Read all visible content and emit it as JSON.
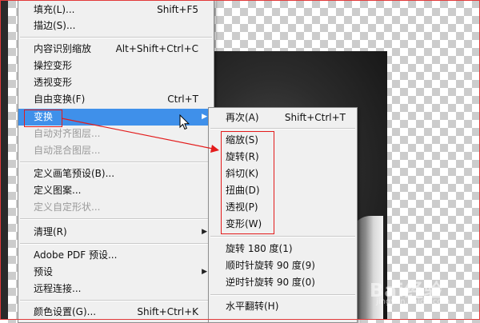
{
  "main_menu": {
    "items": [
      {
        "label": "填充(L)...",
        "shortcut": "Shift+F5"
      },
      {
        "label": "描边(S)..."
      },
      {
        "label": "内容识别缩放",
        "shortcut": "Alt+Shift+Ctrl+C"
      },
      {
        "label": "操控变形"
      },
      {
        "label": "透视变形"
      },
      {
        "label": "自由变换(F)",
        "shortcut": "Ctrl+T"
      },
      {
        "label": "变换",
        "state": "highlighted",
        "has_submenu": true
      },
      {
        "label": "自动对齐图层...",
        "state": "disabled"
      },
      {
        "label": "自动混合图层...",
        "state": "disabled"
      },
      {
        "label": "定义画笔预设(B)..."
      },
      {
        "label": "定义图案..."
      },
      {
        "label": "定义自定形状...",
        "state": "disabled"
      },
      {
        "label": "清理(R)",
        "has_submenu": true
      },
      {
        "label": "Adobe PDF 预设..."
      },
      {
        "label": "预设",
        "has_submenu": true
      },
      {
        "label": "远程连接..."
      },
      {
        "label": "颜色设置(G)...",
        "shortcut": "Shift+Ctrl+K"
      }
    ]
  },
  "sub_menu": {
    "items": [
      {
        "label": "再次(A)",
        "shortcut": "Shift+Ctrl+T"
      },
      {
        "label": "缩放(S)"
      },
      {
        "label": "旋转(R)"
      },
      {
        "label": "斜切(K)"
      },
      {
        "label": "扭曲(D)"
      },
      {
        "label": "透视(P)"
      },
      {
        "label": "变形(W)"
      },
      {
        "label": "旋转 180 度(1)"
      },
      {
        "label": "顺时针旋转 90 度(9)"
      },
      {
        "label": "逆时针旋转 90 度(0)"
      },
      {
        "label": "水平翻转(H)"
      }
    ]
  },
  "icons": {
    "submenu_arrow": "submenu-arrow-icon",
    "cursor": "mouse-pointer-icon"
  },
  "watermark": {
    "text": "Bai经验",
    "subtext": "jingyan.baidu.com"
  },
  "colors": {
    "highlight": "#3f90ea",
    "annotation": "#e31b1b",
    "menu_bg": "#f0f0f0",
    "disabled_text": "#9a9a9a"
  }
}
